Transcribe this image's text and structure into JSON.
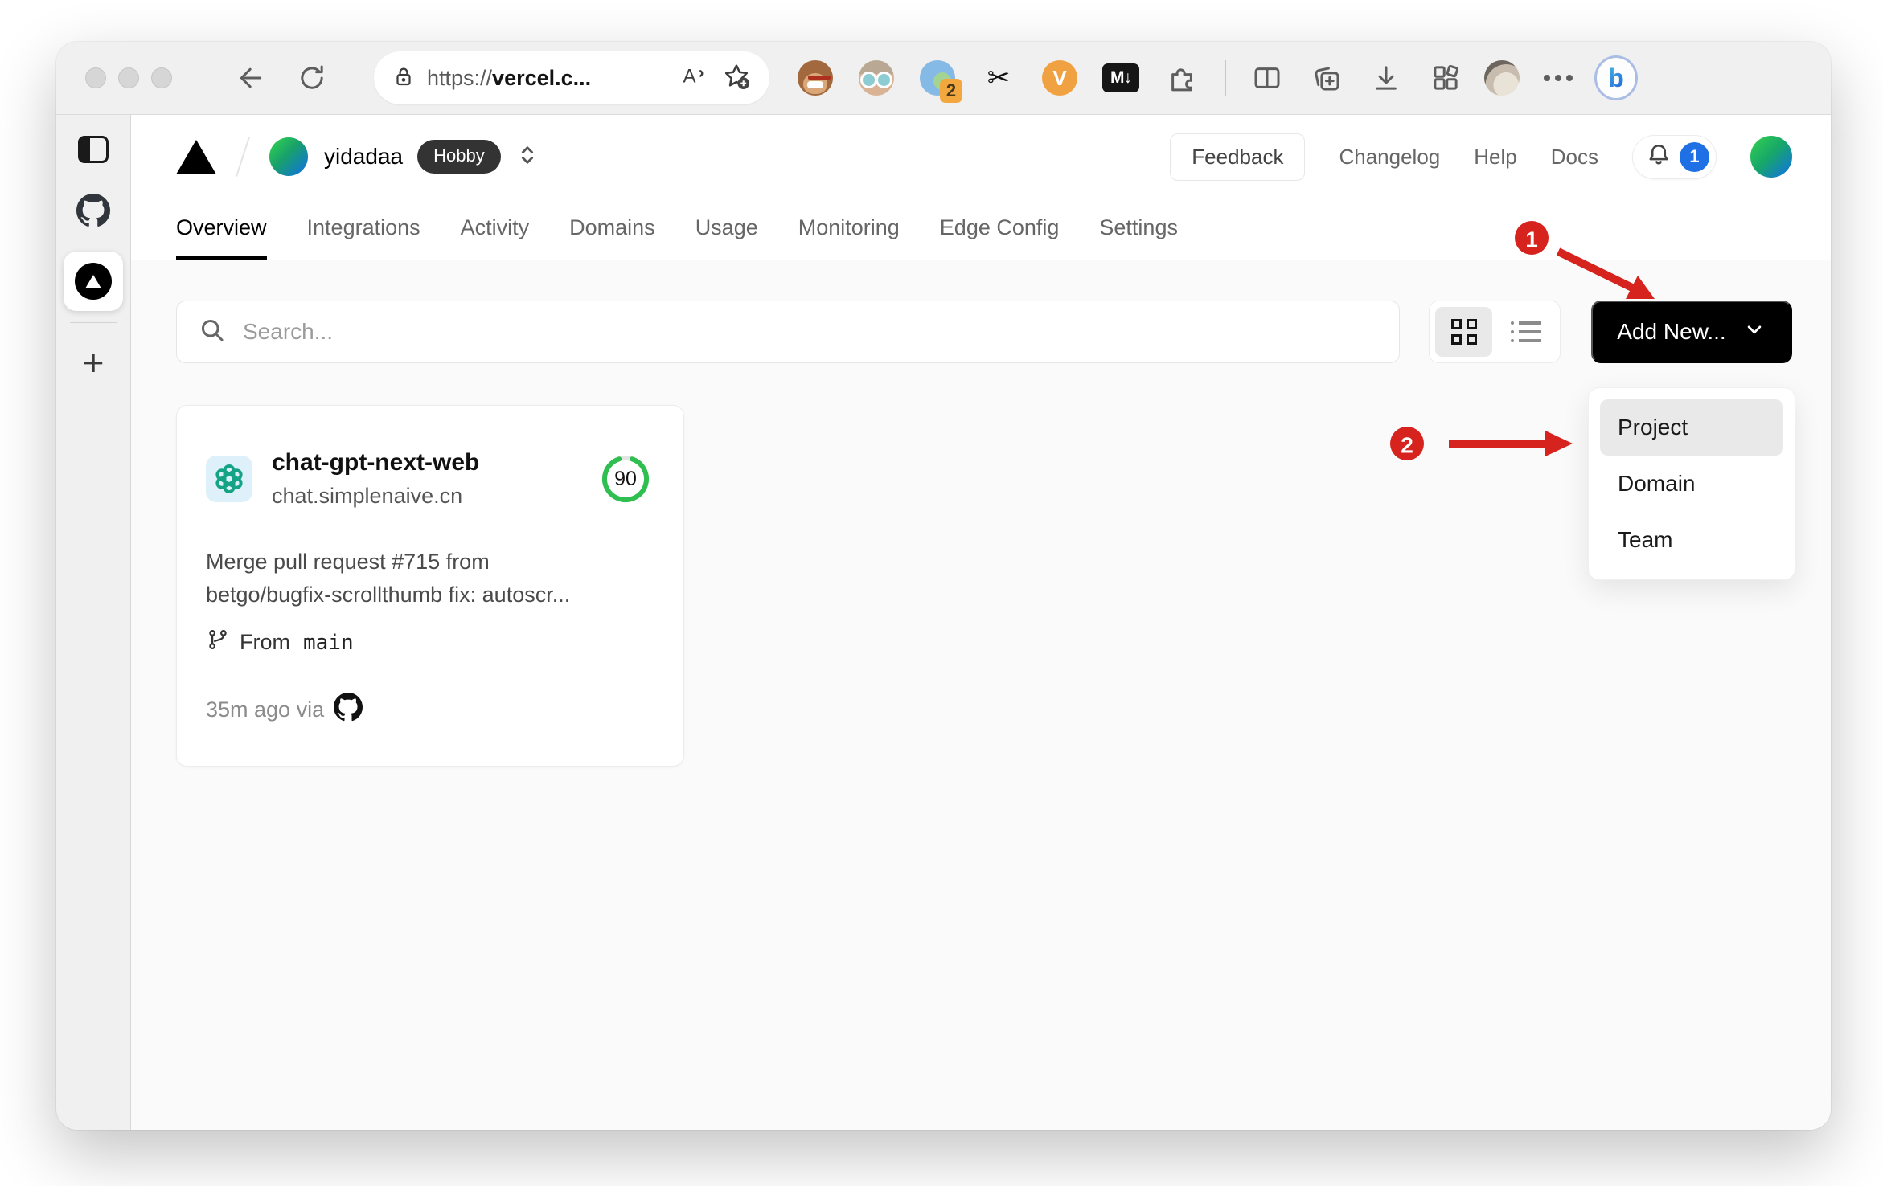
{
  "browser": {
    "url": {
      "scheme": "https://",
      "domain": "vercel.c..."
    },
    "extensions": {
      "profile_badge_count": "2",
      "vimium_label": "V",
      "markdown_label": "M↓",
      "scissors_glyph": "✂",
      "bing_label": "b"
    },
    "new_tab_label": "+"
  },
  "header": {
    "team_name": "yidadaa",
    "plan_badge": "Hobby",
    "feedback_label": "Feedback",
    "links": [
      "Changelog",
      "Help",
      "Docs"
    ],
    "notification_count": "1"
  },
  "tabs": [
    {
      "label": "Overview",
      "active": true
    },
    {
      "label": "Integrations",
      "active": false
    },
    {
      "label": "Activity",
      "active": false
    },
    {
      "label": "Domains",
      "active": false
    },
    {
      "label": "Usage",
      "active": false
    },
    {
      "label": "Monitoring",
      "active": false
    },
    {
      "label": "Edge Config",
      "active": false
    },
    {
      "label": "Settings",
      "active": false
    }
  ],
  "controls": {
    "search_placeholder": "Search...",
    "add_new_label": "Add New..."
  },
  "dropdown": {
    "items": [
      "Project",
      "Domain",
      "Team"
    ],
    "highlighted": "Project"
  },
  "project_card": {
    "name": "chat-gpt-next-web",
    "domain": "chat.simplenaive.cn",
    "score": "90",
    "commit_lines": [
      "Merge pull request #715 from",
      "betgo/bugfix-scrollthumb fix: autoscr..."
    ],
    "branch_prefix": "From",
    "branch_name": "main",
    "deploy_meta": "35m ago via"
  },
  "annotations": {
    "step1": "1",
    "step2": "2"
  },
  "colors": {
    "accent_red": "#d6231e",
    "badge_blue": "#1f6fe5",
    "score_green": "#2fbf50",
    "openai_teal": "#14a385"
  }
}
